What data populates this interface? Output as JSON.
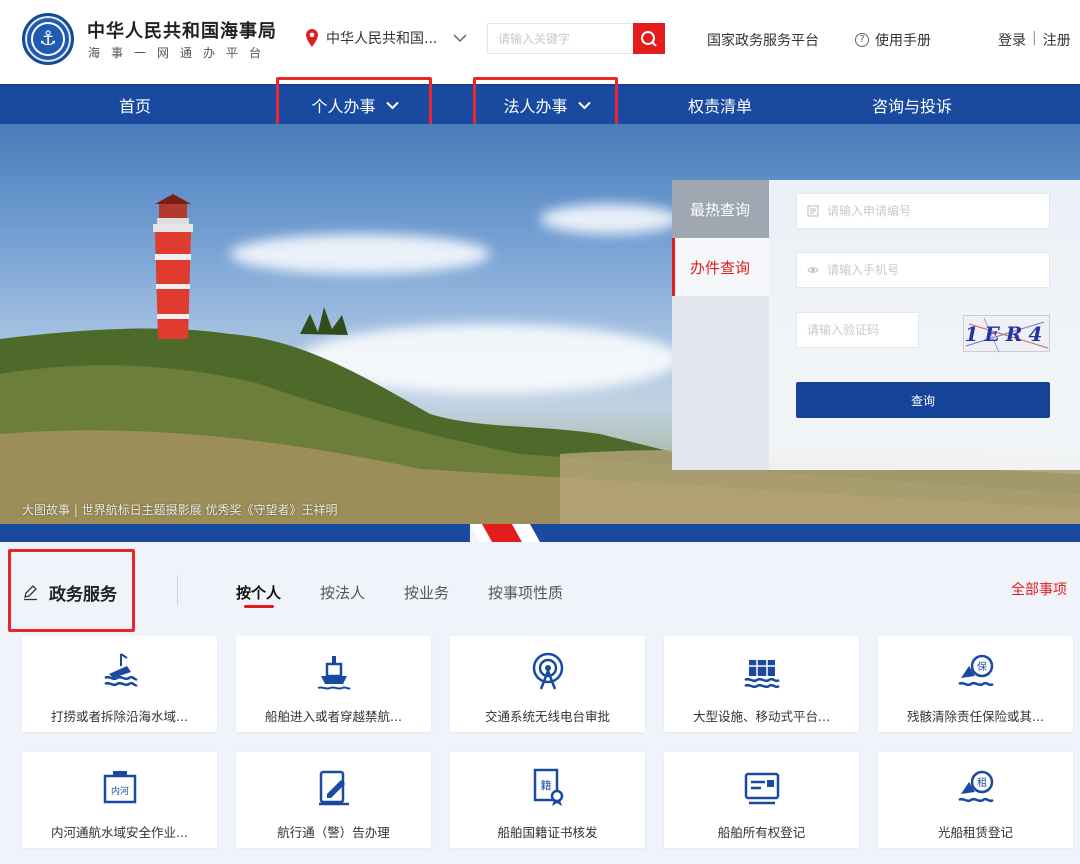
{
  "header": {
    "brand_title": "中华人民共和国海事局",
    "brand_subtitle": "海事一网通办平台",
    "location": "中华人民共和国...",
    "search_placeholder": "请输入关键字",
    "gov_platform_link": "国家政务服务平台",
    "manual_link": "使用手册",
    "login": "登录",
    "auth_separator": "|",
    "register": "注册"
  },
  "nav": {
    "items": [
      {
        "label": "首页"
      },
      {
        "label": "个人办事"
      },
      {
        "label": "法人办事"
      },
      {
        "label": "权责清单"
      },
      {
        "label": "咨询与投诉"
      }
    ]
  },
  "hero": {
    "caption": "大图故事 | 世界航标日主题摄影展 优秀奖《守望者》王祥明"
  },
  "query_panel": {
    "tabs": [
      {
        "label": "最热查询"
      },
      {
        "label": "办件查询"
      }
    ],
    "application_no_placeholder": "请输入申请编号",
    "phone_placeholder": "请输入手机号",
    "captcha_placeholder": "请输入验证码",
    "captcha_text": "1ER4",
    "query_button": "查询"
  },
  "services": {
    "title": "政务服务",
    "tabs": [
      {
        "label": "按个人"
      },
      {
        "label": "按法人"
      },
      {
        "label": "按业务"
      },
      {
        "label": "按事项性质"
      }
    ],
    "all_items": "全部事项",
    "cards": [
      {
        "label": "打捞或者拆除沿海水域...",
        "icon": "salvage-icon"
      },
      {
        "label": "船舶进入或者穿越禁航...",
        "icon": "ship-icon"
      },
      {
        "label": "交通系统无线电台审批",
        "icon": "radio-station-icon"
      },
      {
        "label": "大型设施、移动式平台...",
        "icon": "platform-icon"
      },
      {
        "label": "残骸清除责任保险或其...",
        "icon": "insurance-icon"
      },
      {
        "label": "内河通航水域安全作业...",
        "icon": "inland-river-icon"
      },
      {
        "label": "航行通（警）告办理",
        "icon": "notice-icon"
      },
      {
        "label": "船舶国籍证书核发",
        "icon": "certificate-icon"
      },
      {
        "label": "船舶所有权登记",
        "icon": "ownership-icon"
      },
      {
        "label": "光船租赁登记",
        "icon": "charter-icon"
      }
    ]
  },
  "colors": {
    "nav_blue": "#1a4aa0",
    "accent_red": "#e31c1c",
    "button_blue": "#16439a"
  }
}
